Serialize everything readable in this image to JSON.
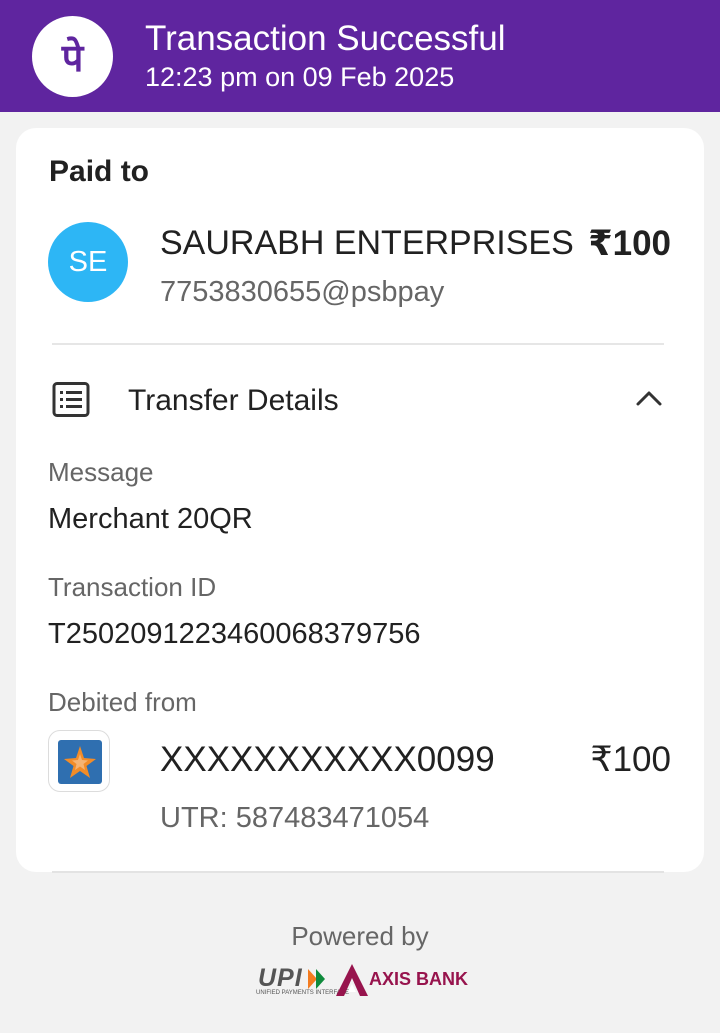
{
  "header": {
    "title": "Transaction Successful",
    "timestamp": "12:23 pm on 09 Feb 2025",
    "brand_color": "#5f259f",
    "logo_glyph": "पे"
  },
  "paid_to": {
    "label": "Paid to",
    "avatar_initials": "SE",
    "avatar_color": "#2db6f5",
    "name": "SAURABH ENTERPRISES",
    "amount": "₹100",
    "vpa": "7753830655@psbpay"
  },
  "transfer_details": {
    "title": "Transfer Details",
    "expanded": true,
    "message_label": "Message",
    "message_value": "Merchant 20QR",
    "txn_id_label": "Transaction ID",
    "txn_id_value": "T2502091223460068379756",
    "debited_label": "Debited from",
    "account": "XXXXXXXXXXX0099",
    "debited_amount": "₹100",
    "utr": "UTR: 587483471054"
  },
  "footer": {
    "powered_by": "Powered by",
    "upi_label": "UPI",
    "upi_subtext": "UNIFIED PAYMENTS INTERFACE",
    "bank_name": "AXIS BANK",
    "bank_color": "#97144d"
  },
  "icons": {
    "app_logo": "phonepe-logo-icon",
    "details": "list-details-icon",
    "collapse": "chevron-up-icon",
    "bank": "bank-star-logo-icon"
  }
}
